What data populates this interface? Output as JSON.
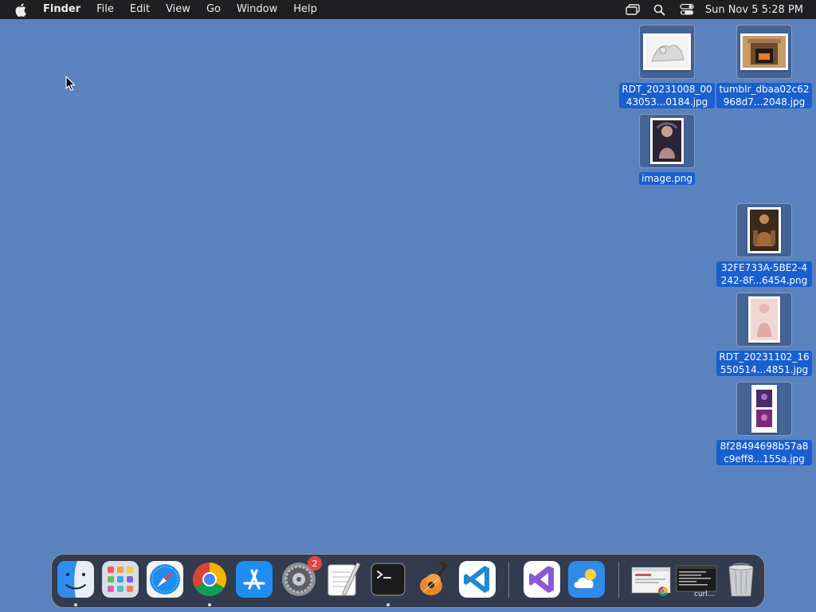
{
  "menubar": {
    "app_name": "Finder",
    "items": [
      "File",
      "Edit",
      "View",
      "Go",
      "Window",
      "Help"
    ],
    "clock": "Sun Nov 5  5:28 PM"
  },
  "desktop_icons": [
    {
      "label": "RDT_20231008_0043053...0184.jpg"
    },
    {
      "label": "tumblr_dbaa02c62968d7...2048.jpg"
    },
    {
      "label": "image.png"
    },
    {
      "label": "32FE733A-5BE2-4242-8F...6454.png"
    },
    {
      "label": "RDT_20231102_16550514...4851.jpg"
    },
    {
      "label": "8f28494698b57a8c9eff8...155a.jpg"
    }
  ],
  "dock": {
    "apps": [
      "finder",
      "launchpad",
      "safari",
      "chrome",
      "app-store",
      "system-settings",
      "textedit",
      "terminal",
      "garageband",
      "vscode",
      "visual-studio",
      "weather"
    ],
    "system_settings_badge": "2",
    "minimized_window_label": "curl..."
  },
  "colors": {
    "desktop": "#5a82bf",
    "selection": "#1a5fd0",
    "menubar": "#1f1f22"
  }
}
